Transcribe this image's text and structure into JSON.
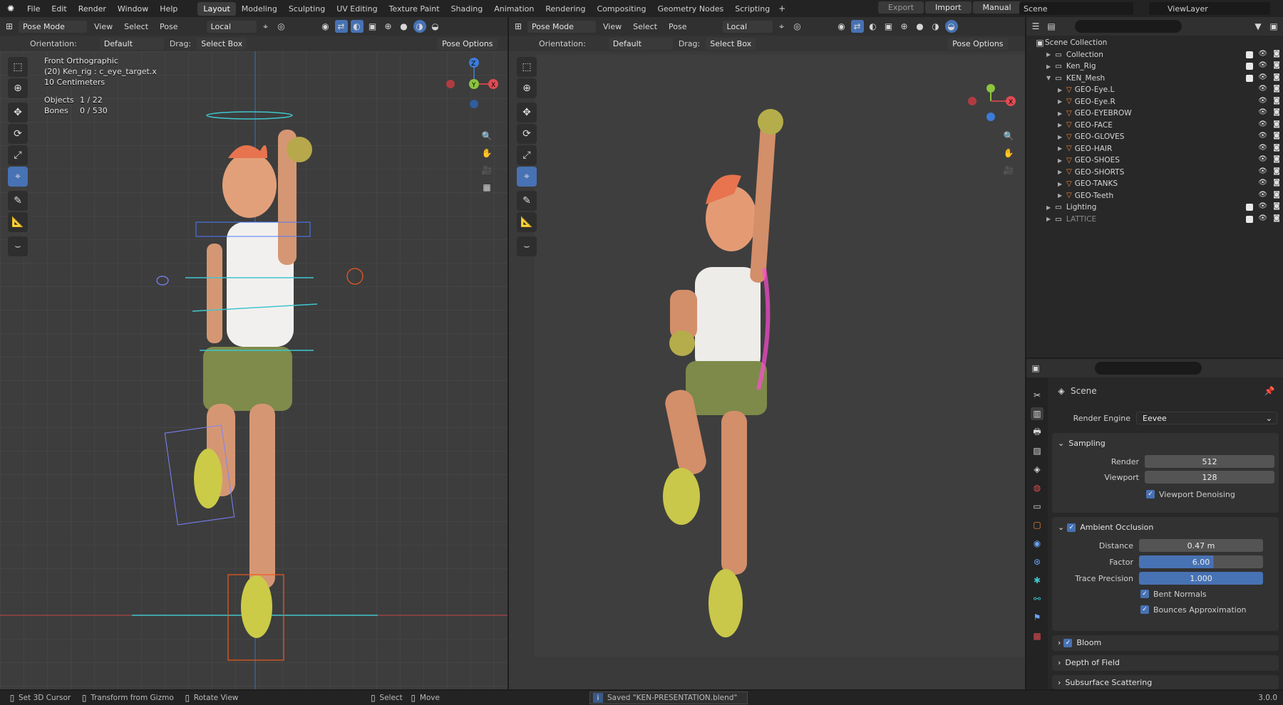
{
  "app": {
    "logo": "blender-logo"
  },
  "menus": [
    "File",
    "Edit",
    "Render",
    "Window",
    "Help"
  ],
  "workspaces": [
    "Layout",
    "Modeling",
    "Sculpting",
    "UV Editing",
    "Texture Paint",
    "Shading",
    "Animation",
    "Rendering",
    "Compositing",
    "Geometry Nodes",
    "Scripting"
  ],
  "active_workspace": "Layout",
  "topright": {
    "export": "Export",
    "import": "Import",
    "manual": "Manual",
    "scene": "Scene",
    "view_layer": "ViewLayer"
  },
  "left_viewport": {
    "mode": "Pose Mode",
    "menus": [
      "View",
      "Select",
      "Pose"
    ],
    "transform": "Local",
    "orientation_label": "Orientation:",
    "orientation": "Default",
    "drag_label": "Drag:",
    "drag": "Select Box",
    "pose_options": "Pose Options",
    "view_name": "Front Orthographic",
    "object_info": "(20) Ken_rig : c_eye_target.x",
    "scale": "10 Centimeters",
    "objects_label": "Objects",
    "objects_value": "1 / 22",
    "bones_label": "Bones",
    "bones_value": "0 / 530"
  },
  "right_viewport": {
    "mode": "Pose Mode",
    "menus": [
      "View",
      "Select",
      "Pose"
    ],
    "transform": "Local",
    "orientation_label": "Orientation:",
    "orientation": "Default",
    "drag_label": "Drag:",
    "drag": "Select Box",
    "pose_options": "Pose Options"
  },
  "outliner": {
    "root": "Scene Collection",
    "items": [
      {
        "name": "Collection",
        "depth": 1,
        "expanded": false
      },
      {
        "name": "Ken_Rig",
        "depth": 1,
        "expanded": false
      },
      {
        "name": "KEN_Mesh",
        "depth": 1,
        "expanded": true
      },
      {
        "name": "GEO-Eye.L",
        "depth": 2,
        "expanded": false
      },
      {
        "name": "GEO-Eye.R",
        "depth": 2,
        "expanded": false
      },
      {
        "name": "GEO-EYEBROW",
        "depth": 2,
        "expanded": false
      },
      {
        "name": "GEO-FACE",
        "depth": 2,
        "expanded": false
      },
      {
        "name": "GEO-GLOVES",
        "depth": 2,
        "expanded": false
      },
      {
        "name": "GEO-HAIR",
        "depth": 2,
        "expanded": false
      },
      {
        "name": "GEO-SHOES",
        "depth": 2,
        "expanded": false
      },
      {
        "name": "GEO-SHORTS",
        "depth": 2,
        "expanded": false
      },
      {
        "name": "GEO-TANKS",
        "depth": 2,
        "expanded": false
      },
      {
        "name": "GEO-Teeth",
        "depth": 2,
        "expanded": false
      },
      {
        "name": "Lighting",
        "depth": 1,
        "expanded": false
      },
      {
        "name": "LATTICE",
        "depth": 1,
        "expanded": false
      }
    ]
  },
  "properties": {
    "context": "Scene",
    "render_engine_label": "Render Engine",
    "render_engine": "Eevee",
    "sampling": {
      "title": "Sampling",
      "render_label": "Render",
      "render": "512",
      "viewport_label": "Viewport",
      "viewport": "128",
      "denoise": "Viewport Denoising"
    },
    "ao": {
      "title": "Ambient Occlusion",
      "distance_label": "Distance",
      "distance": "0.47 m",
      "factor_label": "Factor",
      "factor": "6.00",
      "trace_label": "Trace Precision",
      "trace": "1.000",
      "bent": "Bent Normals",
      "bounces": "Bounces Approximation"
    },
    "bloom": "Bloom",
    "dof": "Depth of Field",
    "sss": "Subsurface Scattering"
  },
  "status": {
    "cursor": "Set 3D Cursor",
    "gizmo": "Transform from Gizmo",
    "rotate": "Rotate View",
    "select": "Select",
    "move": "Move",
    "saved": "Saved \"KEN-PRESENTATION.blend\"",
    "version": "3.0.0"
  }
}
